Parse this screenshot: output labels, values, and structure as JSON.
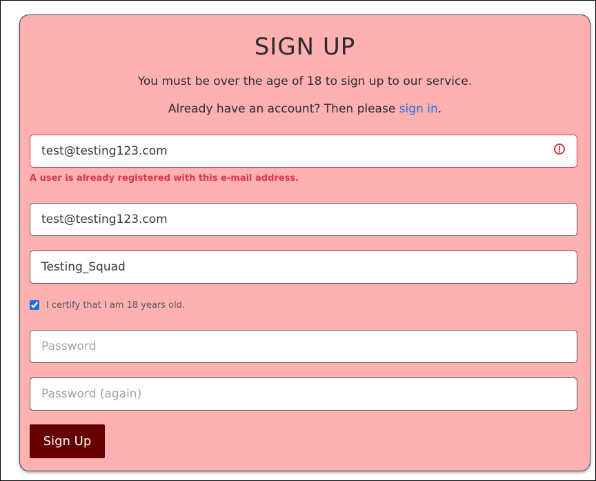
{
  "form": {
    "title": "SIGN UP",
    "subtitle": "You must be over the age of 18 to sign up to our service.",
    "signin_prefix": "Already have an account? Then please ",
    "signin_link": "sign in",
    "signin_suffix": ".",
    "email": {
      "value": "test@testing123.com",
      "error": "A user is already registered with this e-mail address.",
      "error_color": "#dc3545"
    },
    "email_confirm": {
      "value": "test@testing123.com"
    },
    "username": {
      "value": "Testing_Squad"
    },
    "age_checkbox": {
      "checked": true,
      "label": "I certify that I am 18 years old."
    },
    "password": {
      "placeholder": "Password"
    },
    "password_again": {
      "placeholder": "Password (again)"
    },
    "submit_label": "Sign Up"
  },
  "colors": {
    "card_background": "#ffb1b1",
    "submit_background": "#650000",
    "link": "#1a6fe0",
    "error": "#dc3545"
  }
}
